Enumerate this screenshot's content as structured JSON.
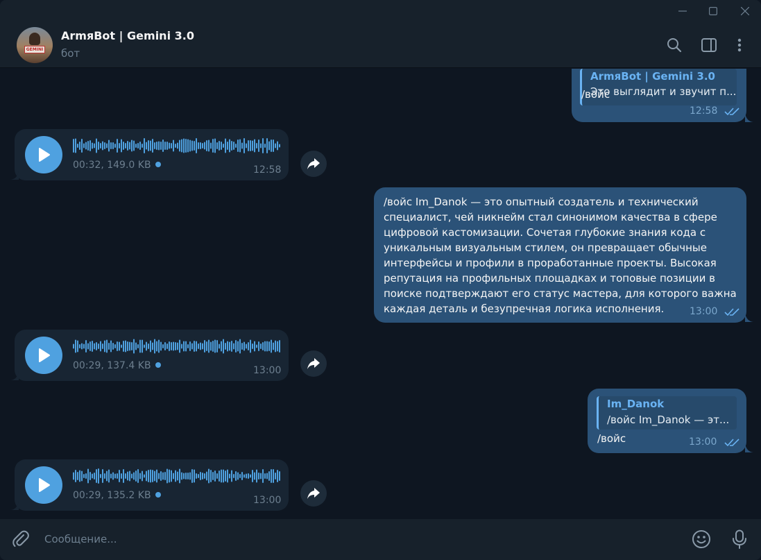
{
  "window_controls": {
    "minimize_icon": "minimize-icon",
    "maximize_icon": "maximize-icon",
    "close_icon": "close-icon"
  },
  "header": {
    "title": "ArmяBot | Gemini 3.0",
    "subtitle": "бот",
    "avatar_sign_text": "GEMINI"
  },
  "messages": [
    {
      "direction": "out",
      "reply_to": {
        "name": "ArmяBot | Gemini 3.0",
        "text": "Это выглядит и звучит п..."
      },
      "text": "/войс",
      "time": "12:58"
    },
    {
      "direction": "in",
      "type": "voice",
      "meta": "00:32, 149.0 KB",
      "time": "12:58"
    },
    {
      "direction": "out",
      "lines": [
        "/войс Im_Danok — это опытный создатель и технический",
        "специалист, чей никнейм стал синонимом качества в сфере",
        "цифровой кастомизации. Сочетая глубокие знания кода с",
        "уникальным визуальным стилем, он превращает обычные",
        "интерфейсы и профили в проработанные проекты. Высокая",
        "репутация на профильных площадках и топовые позиции в",
        "поиске подтверждают его статус мастера, для которого важна",
        "каждая деталь и безупречная логика исполнения."
      ],
      "time": "13:00"
    },
    {
      "direction": "in",
      "type": "voice",
      "meta": "00:29, 137.4 KB",
      "time": "13:00"
    },
    {
      "direction": "out",
      "reply_to": {
        "name": "Im_Danok",
        "text": "/войс Im_Danok — эт..."
      },
      "text": "/войс",
      "time": "13:00"
    },
    {
      "direction": "in",
      "type": "voice",
      "meta": "00:29, 135.2 KB",
      "time": "13:00"
    }
  ],
  "composer": {
    "placeholder": "Сообщение..."
  },
  "colors": {
    "background": "#0e1621",
    "panel": "#17212b",
    "bubble_out": "#2b5278",
    "bubble_in": "#182533",
    "accent": "#4fa1e0",
    "link": "#6ab3f3"
  }
}
